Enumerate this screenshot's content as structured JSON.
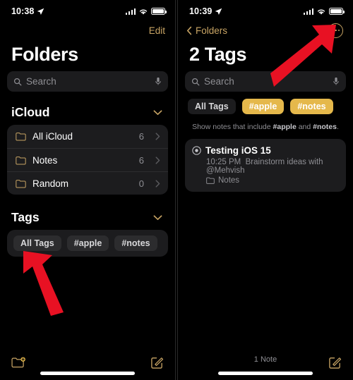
{
  "left": {
    "status": {
      "time": "10:38",
      "location_icon": "location-arrow-icon",
      "cellular_icon": "cellular-bars-icon",
      "wifi_icon": "wifi-icon",
      "battery_icon": "battery-icon"
    },
    "nav": {
      "edit_label": "Edit"
    },
    "title": "Folders",
    "search": {
      "placeholder": "Search",
      "search_icon": "search-icon",
      "mic_icon": "microphone-icon"
    },
    "icloud_section": {
      "header": "iCloud",
      "collapse_icon": "chevron-down-icon",
      "rows": [
        {
          "label": "All iCloud",
          "count": "6",
          "icon": "folder-icon",
          "chevron": "chevron-right-icon"
        },
        {
          "label": "Notes",
          "count": "6",
          "icon": "folder-icon",
          "chevron": "chevron-right-icon"
        },
        {
          "label": "Random",
          "count": "0",
          "icon": "folder-icon",
          "chevron": "chevron-right-icon"
        }
      ]
    },
    "tags_section": {
      "header": "Tags",
      "collapse_icon": "chevron-down-icon",
      "chips": [
        {
          "label": "All Tags",
          "selected": false
        },
        {
          "label": "#apple",
          "selected": false
        },
        {
          "label": "#notes",
          "selected": false
        }
      ]
    },
    "bottom": {
      "new_folder_icon": "new-folder-icon",
      "compose_icon": "compose-note-icon"
    },
    "annotation": {
      "arrow_icon": "red-arrow-icon",
      "points_at": "All Tags"
    }
  },
  "right": {
    "status": {
      "time": "10:39",
      "location_icon": "location-arrow-icon",
      "cellular_icon": "cellular-bars-icon",
      "wifi_icon": "wifi-icon",
      "battery_icon": "battery-icon"
    },
    "nav": {
      "back_label": "Folders",
      "back_icon": "chevron-left-icon",
      "more_icon": "ellipsis-circle-icon"
    },
    "title": "2 Tags",
    "search": {
      "placeholder": "Search",
      "search_icon": "search-icon",
      "mic_icon": "microphone-icon"
    },
    "chips": [
      {
        "label": "All Tags",
        "selected": false
      },
      {
        "label": "#apple",
        "selected": true
      },
      {
        "label": "#notes",
        "selected": true
      }
    ],
    "hint": {
      "prefix": "Show notes that include ",
      "tag1": "#apple",
      "middle": " and ",
      "tag2": "#notes",
      "suffix": "."
    },
    "notes": [
      {
        "shared_icon": "shared-note-icon",
        "title": "Testing iOS 15",
        "time": "10:25 PM",
        "preview": "Brainstorm ideas with @Mehvish",
        "folder_icon": "folder-icon",
        "folder": "Notes"
      }
    ],
    "bottom": {
      "count_label": "1 Note",
      "compose_icon": "compose-note-icon"
    },
    "annotation": {
      "arrow_icon": "red-arrow-icon",
      "points_at": "#apple"
    }
  },
  "colors": {
    "accent_gold": "#C8A464",
    "selected_tag": "#E5B84B",
    "background": "#000000",
    "card": "#1C1C1E",
    "arrow_red": "#E81123"
  }
}
